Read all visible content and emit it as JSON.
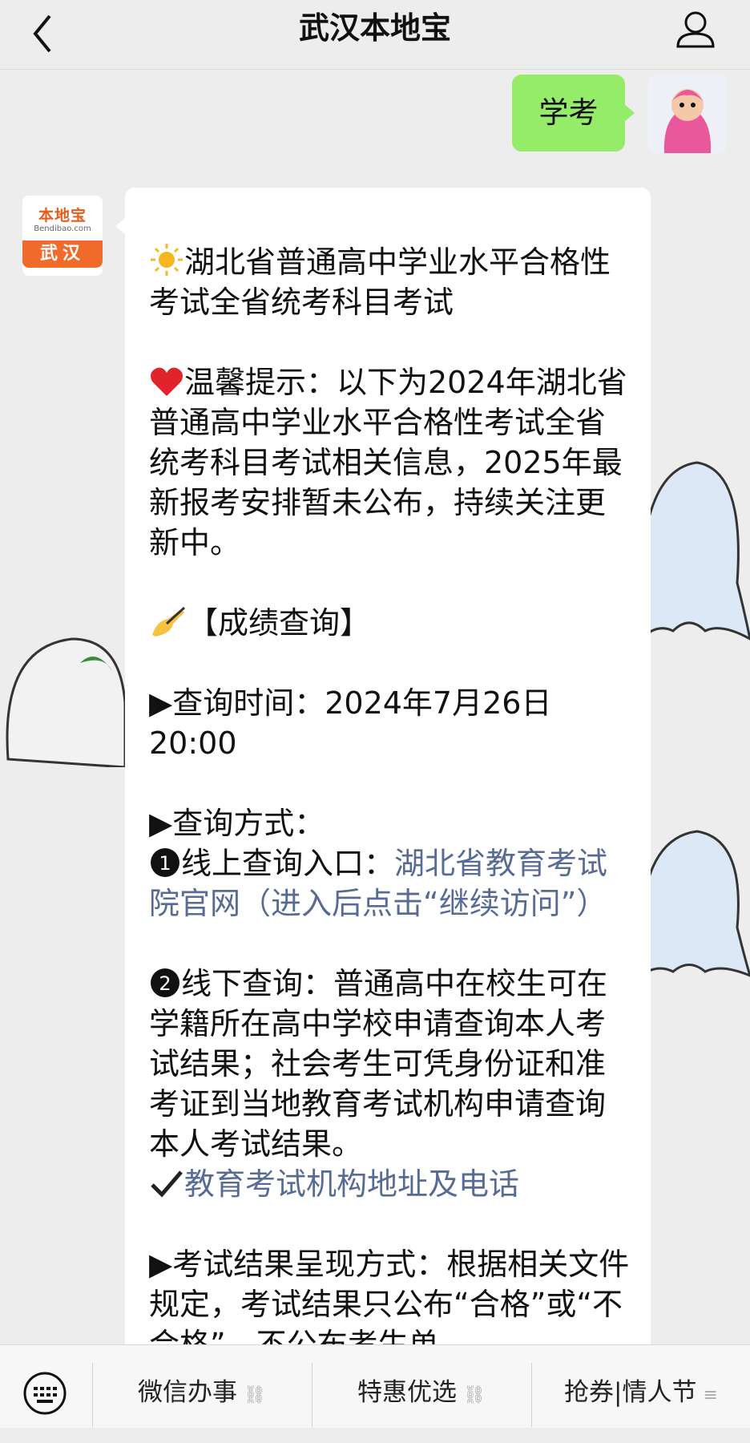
{
  "header": {
    "title": "武汉本地宝"
  },
  "me": {
    "message": "学考"
  },
  "bot": {
    "avatar_brand": "本地宝",
    "avatar_site": "Bendibao.com",
    "avatar_city": "武汉",
    "lines": {
      "p1": "湖北省普通高中学业水平合格性考试全省统考科目考试",
      "p2": "温馨提示：以下为2024年湖北省普通高中学业水平合格性考试全省统考科目考试相关信息，2025年最新报考安排暂未公布，持续关注更新中。",
      "p3": "【成绩查询】",
      "p4": "▶查询时间：2024年7月26日20:00",
      "p5": "▶查询方式：",
      "p6_label": "线上查询入口：",
      "p6_link": "湖北省教育考试院官网（进入后点击“继续访问”）",
      "p7": "线下查询：普通高中在校生可在学籍所在高中学校申请查询本人考试结果；社会考生可凭身份证和准考证到当地教育考试机构申请查询本人考试结果。",
      "p7_link": "教育考试机构地址及电话",
      "p8": "▶考试结果呈现方式：根据相关文件规定，考试结果只公布“合格”或“不合格”，不公布考生单"
    }
  },
  "bottom_menu": {
    "item1": "微信办事",
    "item2": "特惠优选",
    "item3": "抢券|情人节"
  }
}
